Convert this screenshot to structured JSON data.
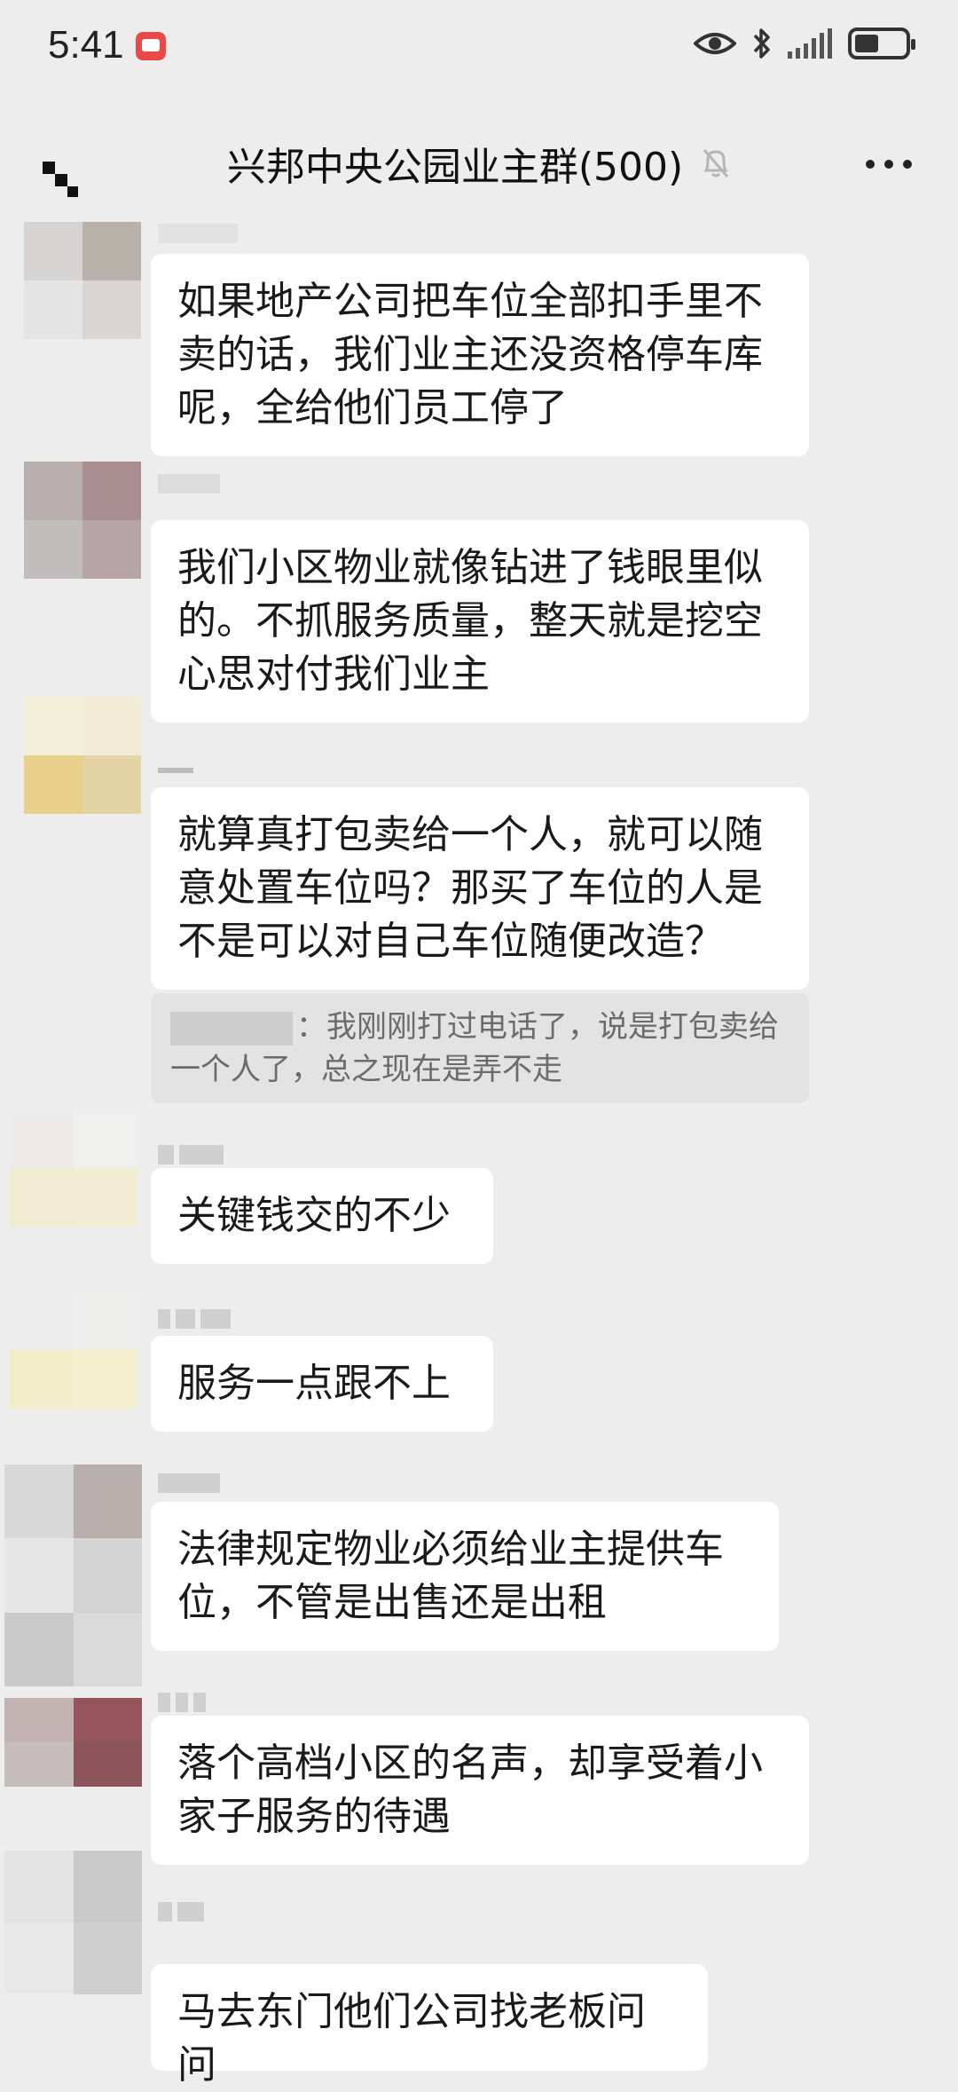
{
  "status_bar": {
    "time": "5:41"
  },
  "header": {
    "title": "兴邦中央公园业主群(500)"
  },
  "messages": [
    {
      "text": "如果地产公司把车位全部扣手里不卖的话，我们业主还没资格停车库呢，全给他们员工停了"
    },
    {
      "text": "我们小区物业就像钻进了钱眼里似的。不抓服务质量，整天就是挖空心思对付我们业主"
    },
    {
      "text": "就算真打包卖给一个人，就可以随意处置车位吗？那买了车位的人是不是可以对自己车位随便改造？",
      "quote": "：我刚刚打过电话了，说是打包卖给一个人了，总之现在是弄不走"
    },
    {
      "text": "关键钱交的不少"
    },
    {
      "text": "服务一点跟不上"
    },
    {
      "text": "法律规定物业必须给业主提供车位，不管是出售还是出租"
    },
    {
      "text": "落个高档小区的名声，却享受着小家子服务的待遇"
    },
    {
      "text": "马去东门他们公司找老板问问"
    }
  ],
  "colors": {
    "background": "#ededed",
    "bubble": "#ffffff",
    "quote_bg": "#e3e3e3",
    "notification": "#e84a4a"
  },
  "icons": [
    "notification-icon",
    "eye-icon",
    "bluetooth-icon",
    "signal-icon",
    "battery-icon",
    "back-icon",
    "mute-bell-icon",
    "more-icon"
  ]
}
